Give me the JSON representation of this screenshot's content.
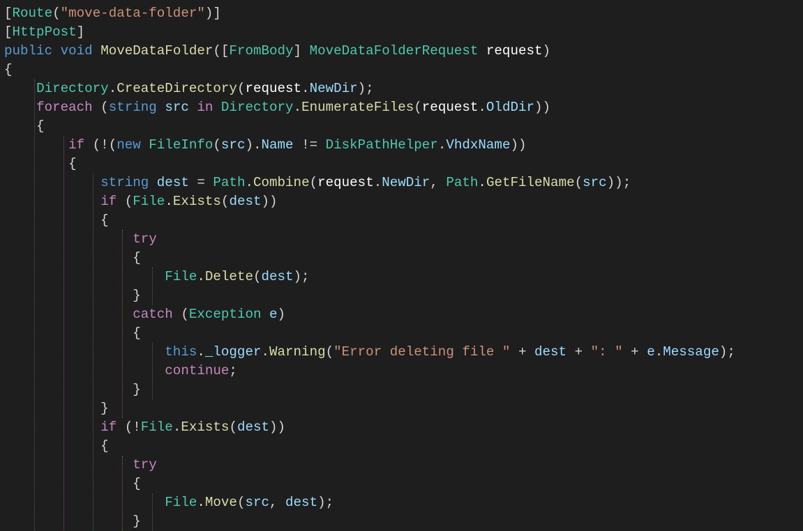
{
  "code": {
    "tokens": [
      {
        "cls": "c-default",
        "txt": "["
      },
      {
        "cls": "c-type",
        "txt": "Route"
      },
      {
        "cls": "c-default",
        "txt": "("
      },
      {
        "cls": "c-string",
        "txt": "\"move-data-folder\""
      },
      {
        "cls": "c-default",
        "txt": ")]"
      },
      {
        "nl": true
      },
      {
        "cls": "c-default",
        "txt": "["
      },
      {
        "cls": "c-type",
        "txt": "HttpPost"
      },
      {
        "cls": "c-default",
        "txt": "]"
      },
      {
        "nl": true
      },
      {
        "cls": "c-keyword",
        "txt": "public"
      },
      {
        "cls": "c-default",
        "txt": " "
      },
      {
        "cls": "c-keyword",
        "txt": "void"
      },
      {
        "cls": "c-default",
        "txt": " "
      },
      {
        "cls": "c-method",
        "txt": "MoveDataFolder"
      },
      {
        "cls": "c-default",
        "txt": "(["
      },
      {
        "cls": "c-type",
        "txt": "FromBody"
      },
      {
        "cls": "c-default",
        "txt": "] "
      },
      {
        "cls": "c-type",
        "txt": "MoveDataFolderRequest"
      },
      {
        "cls": "c-default",
        "txt": " "
      },
      {
        "cls": "c-white",
        "txt": "request"
      },
      {
        "cls": "c-default",
        "txt": ")"
      },
      {
        "nl": true
      },
      {
        "cls": "c-default",
        "txt": "{"
      },
      {
        "nl": true
      },
      {
        "cls": "c-default",
        "txt": "    "
      },
      {
        "cls": "c-type",
        "txt": "Directory"
      },
      {
        "cls": "c-default",
        "txt": "."
      },
      {
        "cls": "c-method",
        "txt": "CreateDirectory"
      },
      {
        "cls": "c-default",
        "txt": "("
      },
      {
        "cls": "c-white",
        "txt": "request"
      },
      {
        "cls": "c-default",
        "txt": "."
      },
      {
        "cls": "c-param",
        "txt": "NewDir"
      },
      {
        "cls": "c-default",
        "txt": ");"
      },
      {
        "nl": true
      },
      {
        "cls": "c-default",
        "txt": "    "
      },
      {
        "cls": "c-control",
        "txt": "foreach"
      },
      {
        "cls": "c-default",
        "txt": " ("
      },
      {
        "cls": "c-keyword",
        "txt": "string"
      },
      {
        "cls": "c-default",
        "txt": " "
      },
      {
        "cls": "c-param",
        "txt": "src"
      },
      {
        "cls": "c-default",
        "txt": " "
      },
      {
        "cls": "c-control",
        "txt": "in"
      },
      {
        "cls": "c-default",
        "txt": " "
      },
      {
        "cls": "c-type",
        "txt": "Directory"
      },
      {
        "cls": "c-default",
        "txt": "."
      },
      {
        "cls": "c-method",
        "txt": "EnumerateFiles"
      },
      {
        "cls": "c-default",
        "txt": "("
      },
      {
        "cls": "c-white",
        "txt": "request"
      },
      {
        "cls": "c-default",
        "txt": "."
      },
      {
        "cls": "c-param",
        "txt": "OldDir"
      },
      {
        "cls": "c-default",
        "txt": "))"
      },
      {
        "nl": true
      },
      {
        "cls": "c-default",
        "txt": "    {"
      },
      {
        "nl": true
      },
      {
        "cls": "c-default",
        "txt": "        "
      },
      {
        "cls": "c-control",
        "txt": "if"
      },
      {
        "cls": "c-default",
        "txt": " (!("
      },
      {
        "cls": "c-keyword",
        "txt": "new"
      },
      {
        "cls": "c-default",
        "txt": " "
      },
      {
        "cls": "c-type",
        "txt": "FileInfo"
      },
      {
        "cls": "c-default",
        "txt": "("
      },
      {
        "cls": "c-param",
        "txt": "src"
      },
      {
        "cls": "c-default",
        "txt": ")."
      },
      {
        "cls": "c-param",
        "txt": "Name"
      },
      {
        "cls": "c-default",
        "txt": " != "
      },
      {
        "cls": "c-type",
        "txt": "DiskPathHelper"
      },
      {
        "cls": "c-default",
        "txt": "."
      },
      {
        "cls": "c-param",
        "txt": "VhdxName"
      },
      {
        "cls": "c-default",
        "txt": "))"
      },
      {
        "nl": true
      },
      {
        "cls": "c-default",
        "txt": "        {"
      },
      {
        "nl": true
      },
      {
        "cls": "c-default",
        "txt": "            "
      },
      {
        "cls": "c-keyword",
        "txt": "string"
      },
      {
        "cls": "c-default",
        "txt": " "
      },
      {
        "cls": "c-param",
        "txt": "dest"
      },
      {
        "cls": "c-default",
        "txt": " = "
      },
      {
        "cls": "c-type",
        "txt": "Path"
      },
      {
        "cls": "c-default",
        "txt": "."
      },
      {
        "cls": "c-method",
        "txt": "Combine"
      },
      {
        "cls": "c-default",
        "txt": "("
      },
      {
        "cls": "c-white",
        "txt": "request"
      },
      {
        "cls": "c-default",
        "txt": "."
      },
      {
        "cls": "c-param",
        "txt": "NewDir"
      },
      {
        "cls": "c-default",
        "txt": ", "
      },
      {
        "cls": "c-type",
        "txt": "Path"
      },
      {
        "cls": "c-default",
        "txt": "."
      },
      {
        "cls": "c-method",
        "txt": "GetFileName"
      },
      {
        "cls": "c-default",
        "txt": "("
      },
      {
        "cls": "c-param",
        "txt": "src"
      },
      {
        "cls": "c-default",
        "txt": "));"
      },
      {
        "nl": true
      },
      {
        "cls": "c-default",
        "txt": "            "
      },
      {
        "cls": "c-control",
        "txt": "if"
      },
      {
        "cls": "c-default",
        "txt": " ("
      },
      {
        "cls": "c-type",
        "txt": "File"
      },
      {
        "cls": "c-default",
        "txt": "."
      },
      {
        "cls": "c-method",
        "txt": "Exists"
      },
      {
        "cls": "c-default",
        "txt": "("
      },
      {
        "cls": "c-param",
        "txt": "dest"
      },
      {
        "cls": "c-default",
        "txt": "))"
      },
      {
        "nl": true
      },
      {
        "cls": "c-default",
        "txt": "            {"
      },
      {
        "nl": true
      },
      {
        "cls": "c-default",
        "txt": "                "
      },
      {
        "cls": "c-control",
        "txt": "try"
      },
      {
        "nl": true
      },
      {
        "cls": "c-default",
        "txt": "                {"
      },
      {
        "nl": true
      },
      {
        "cls": "c-default",
        "txt": "                    "
      },
      {
        "cls": "c-type",
        "txt": "File"
      },
      {
        "cls": "c-default",
        "txt": "."
      },
      {
        "cls": "c-method",
        "txt": "Delete"
      },
      {
        "cls": "c-default",
        "txt": "("
      },
      {
        "cls": "c-param",
        "txt": "dest"
      },
      {
        "cls": "c-default",
        "txt": ");"
      },
      {
        "nl": true
      },
      {
        "cls": "c-default",
        "txt": "                }"
      },
      {
        "nl": true
      },
      {
        "cls": "c-default",
        "txt": "                "
      },
      {
        "cls": "c-control",
        "txt": "catch"
      },
      {
        "cls": "c-default",
        "txt": " ("
      },
      {
        "cls": "c-type",
        "txt": "Exception"
      },
      {
        "cls": "c-default",
        "txt": " "
      },
      {
        "cls": "c-param",
        "txt": "e"
      },
      {
        "cls": "c-default",
        "txt": ")"
      },
      {
        "nl": true
      },
      {
        "cls": "c-default",
        "txt": "                {"
      },
      {
        "nl": true
      },
      {
        "cls": "c-default",
        "txt": "                    "
      },
      {
        "cls": "c-keyword",
        "txt": "this"
      },
      {
        "cls": "c-default",
        "txt": "."
      },
      {
        "cls": "c-param",
        "txt": "_logger"
      },
      {
        "cls": "c-default",
        "txt": "."
      },
      {
        "cls": "c-method",
        "txt": "Warning"
      },
      {
        "cls": "c-default",
        "txt": "("
      },
      {
        "cls": "c-string",
        "txt": "\"Error deleting file \""
      },
      {
        "cls": "c-default",
        "txt": " + "
      },
      {
        "cls": "c-param",
        "txt": "dest"
      },
      {
        "cls": "c-default",
        "txt": " + "
      },
      {
        "cls": "c-string",
        "txt": "\": \""
      },
      {
        "cls": "c-default",
        "txt": " + "
      },
      {
        "cls": "c-param",
        "txt": "e"
      },
      {
        "cls": "c-default",
        "txt": "."
      },
      {
        "cls": "c-param",
        "txt": "Message"
      },
      {
        "cls": "c-default",
        "txt": ");"
      },
      {
        "nl": true
      },
      {
        "cls": "c-default",
        "txt": "                    "
      },
      {
        "cls": "c-control",
        "txt": "continue"
      },
      {
        "cls": "c-default",
        "txt": ";"
      },
      {
        "nl": true
      },
      {
        "cls": "c-default",
        "txt": "                }"
      },
      {
        "nl": true
      },
      {
        "cls": "c-default",
        "txt": "            }"
      },
      {
        "nl": true
      },
      {
        "cls": "c-default",
        "txt": "            "
      },
      {
        "cls": "c-control",
        "txt": "if"
      },
      {
        "cls": "c-default",
        "txt": " (!"
      },
      {
        "cls": "c-type",
        "txt": "File"
      },
      {
        "cls": "c-default",
        "txt": "."
      },
      {
        "cls": "c-method",
        "txt": "Exists"
      },
      {
        "cls": "c-default",
        "txt": "("
      },
      {
        "cls": "c-param",
        "txt": "dest"
      },
      {
        "cls": "c-default",
        "txt": "))"
      },
      {
        "nl": true
      },
      {
        "cls": "c-default",
        "txt": "            {"
      },
      {
        "nl": true
      },
      {
        "cls": "c-default",
        "txt": "                "
      },
      {
        "cls": "c-control",
        "txt": "try"
      },
      {
        "nl": true
      },
      {
        "cls": "c-default",
        "txt": "                {"
      },
      {
        "nl": true
      },
      {
        "cls": "c-default",
        "txt": "                    "
      },
      {
        "cls": "c-type",
        "txt": "File"
      },
      {
        "cls": "c-default",
        "txt": "."
      },
      {
        "cls": "c-method",
        "txt": "Move"
      },
      {
        "cls": "c-default",
        "txt": "("
      },
      {
        "cls": "c-param",
        "txt": "src"
      },
      {
        "cls": "c-default",
        "txt": ", "
      },
      {
        "cls": "c-param",
        "txt": "dest"
      },
      {
        "cls": "c-default",
        "txt": ");"
      },
      {
        "nl": true
      },
      {
        "cls": "c-default",
        "txt": "                }"
      },
      {
        "nl": true
      }
    ]
  },
  "guides": [
    {
      "col": 1,
      "fromLine": 5,
      "toLine": 28,
      "color": "#565656"
    },
    {
      "col": 2,
      "fromLine": 8,
      "toLine": 28,
      "color": "#7a4a7a"
    },
    {
      "col": 3,
      "fromLine": 10,
      "toLine": 28,
      "color": "#3a6a6a"
    },
    {
      "col": 4,
      "fromLine": 13,
      "toLine": 22,
      "color": "#7a6a3a"
    },
    {
      "col": 5,
      "fromLine": 15,
      "toLine": 16,
      "color": "#565656"
    },
    {
      "col": 5,
      "fromLine": 19,
      "toLine": 21,
      "color": "#565656"
    },
    {
      "col": 4,
      "fromLine": 25,
      "toLine": 28,
      "color": "#7a6a3a"
    },
    {
      "col": 5,
      "fromLine": 27,
      "toLine": 28,
      "color": "#565656"
    }
  ],
  "metrics": {
    "lineHeight": 27,
    "charWidth": 10.56,
    "topPad": 6,
    "leftPad": 6,
    "indentSize": 4
  }
}
